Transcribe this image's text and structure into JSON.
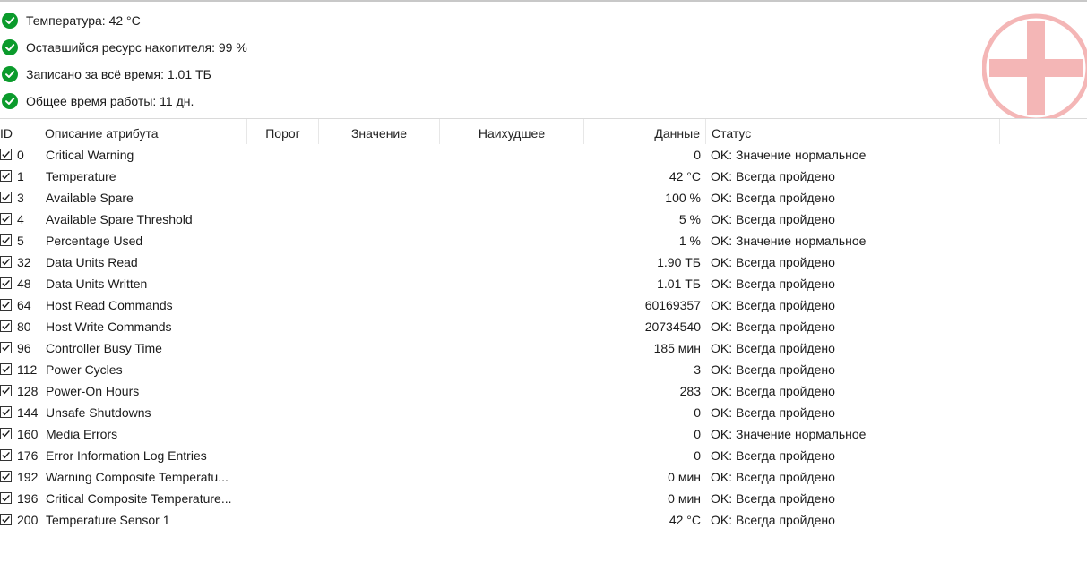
{
  "summary": [
    {
      "text": "Температура: 42 °C"
    },
    {
      "text": "Оставшийся ресурс накопителя: 99 %"
    },
    {
      "text": "Записано за всё время: 1.01 ТБ"
    },
    {
      "text": "Общее время работы: 11 дн."
    }
  ],
  "status_color": "#0b9b2c",
  "logo_color": "#f4b6b6",
  "table": {
    "columns": {
      "id": "ID",
      "description": "Описание атрибута",
      "threshold": "Порог",
      "value": "Значение",
      "worst": "Наихудшее",
      "data": "Данные",
      "status": "Статус"
    },
    "rows": [
      {
        "id": "0",
        "name": "Critical Warning",
        "data": "0",
        "status": "OK: Значение нормальное"
      },
      {
        "id": "1",
        "name": "Temperature",
        "data": "42 °C",
        "status": "OK: Всегда пройдено"
      },
      {
        "id": "3",
        "name": "Available Spare",
        "data": "100 %",
        "status": "OK: Всегда пройдено"
      },
      {
        "id": "4",
        "name": "Available Spare Threshold",
        "data": "5 %",
        "status": "OK: Всегда пройдено"
      },
      {
        "id": "5",
        "name": "Percentage Used",
        "data": "1 %",
        "status": "OK: Значение нормальное"
      },
      {
        "id": "32",
        "name": "Data Units Read",
        "data": "1.90 ТБ",
        "status": "OK: Всегда пройдено"
      },
      {
        "id": "48",
        "name": "Data Units Written",
        "data": "1.01 ТБ",
        "status": "OK: Всегда пройдено"
      },
      {
        "id": "64",
        "name": "Host Read Commands",
        "data": "60169357",
        "status": "OK: Всегда пройдено"
      },
      {
        "id": "80",
        "name": "Host Write Commands",
        "data": "20734540",
        "status": "OK: Всегда пройдено"
      },
      {
        "id": "96",
        "name": "Controller Busy Time",
        "data": "185 мин",
        "status": "OK: Всегда пройдено"
      },
      {
        "id": "112",
        "name": "Power Cycles",
        "data": "3",
        "status": "OK: Всегда пройдено"
      },
      {
        "id": "128",
        "name": "Power-On Hours",
        "data": "283",
        "status": "OK: Всегда пройдено"
      },
      {
        "id": "144",
        "name": "Unsafe Shutdowns",
        "data": "0",
        "status": "OK: Всегда пройдено"
      },
      {
        "id": "160",
        "name": "Media Errors",
        "data": "0",
        "status": "OK: Значение нормальное"
      },
      {
        "id": "176",
        "name": "Error Information Log Entries",
        "data": "0",
        "status": "OK: Всегда пройдено"
      },
      {
        "id": "192",
        "name": "Warning Composite Temperatu...",
        "data": "0 мин",
        "status": "OK: Всегда пройдено"
      },
      {
        "id": "196",
        "name": "Critical Composite Temperature...",
        "data": "0 мин",
        "status": "OK: Всегда пройдено"
      },
      {
        "id": "200",
        "name": "Temperature Sensor 1",
        "data": "42 °C",
        "status": "OK: Всегда пройдено"
      }
    ]
  }
}
